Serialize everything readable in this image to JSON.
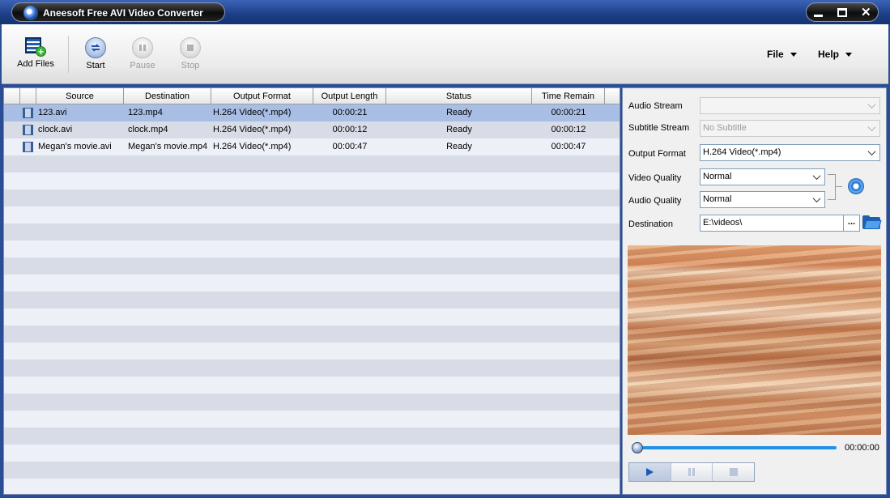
{
  "window": {
    "title": "Aneesoft Free AVI Video Converter"
  },
  "toolbar": {
    "add_files": "Add Files",
    "start": "Start",
    "pause": "Pause",
    "stop": "Stop",
    "menu_file": "File",
    "menu_help": "Help"
  },
  "table": {
    "columns": [
      "Source",
      "Destination",
      "Output Format",
      "Output Length",
      "Status",
      "Time Remain"
    ],
    "rows": [
      {
        "source": "123.avi",
        "destination": "123.mp4",
        "format": "H.264 Video(*.mp4)",
        "length": "00:00:21",
        "status": "Ready",
        "remain": "00:00:21",
        "selected": true
      },
      {
        "source": "clock.avi",
        "destination": "clock.mp4",
        "format": "H.264 Video(*.mp4)",
        "length": "00:00:12",
        "status": "Ready",
        "remain": "00:00:12"
      },
      {
        "source": "Megan's movie.avi",
        "destination": "Megan's movie.mp4",
        "format": "H.264 Video(*.mp4)",
        "length": "00:00:47",
        "status": "Ready",
        "remain": "00:00:47"
      }
    ]
  },
  "settings": {
    "audio_stream_label": "Audio Stream",
    "audio_stream_value": "",
    "subtitle_stream_label": "Subtitle Stream",
    "subtitle_stream_value": "No Subtitle",
    "output_format_label": "Output Format",
    "output_format_value": "H.264 Video(*.mp4)",
    "video_quality_label": "Video Quality",
    "video_quality_value": "Normal",
    "audio_quality_label": "Audio Quality",
    "audio_quality_value": "Normal",
    "destination_label": "Destination",
    "destination_value": "E:\\videos\\",
    "browse_label": "..."
  },
  "player": {
    "time": "00:00:00",
    "progress": 0
  }
}
